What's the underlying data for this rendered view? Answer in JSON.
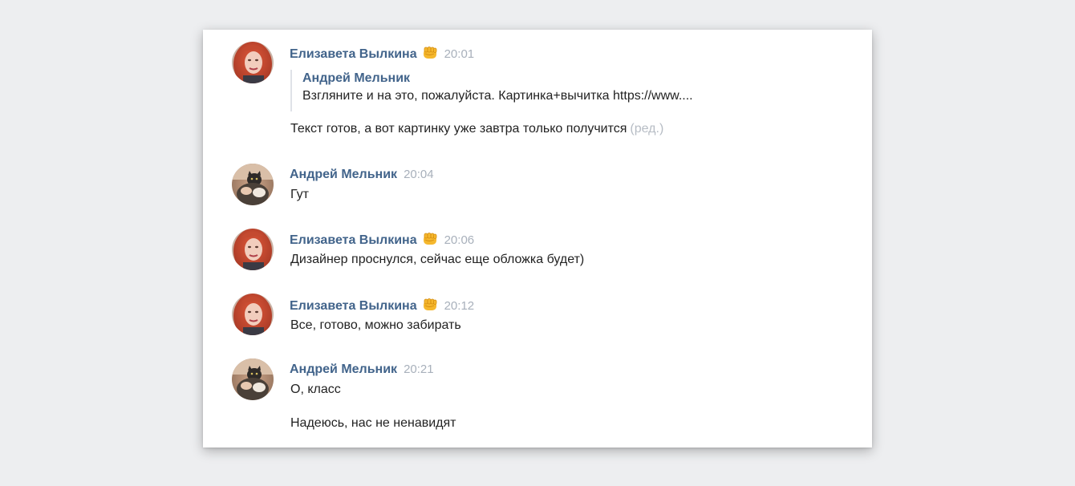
{
  "colors": {
    "background": "#edeef0",
    "author": "#42648b",
    "time": "#a8b0bb",
    "text": "#222222",
    "edited": "#b6bcc4",
    "quote_border": "#dfe2e8"
  },
  "messages": [
    {
      "author": "Елизавета Вылкина",
      "author_emoji": "fist-emoji",
      "time": "20:01",
      "quote": {
        "author": "Андрей Мельник",
        "text": "Взгляните и на это, пожалуйста. Картинка+вычитка https://www...."
      },
      "text": "Текст готов, а вот картинку уже завтра только получится",
      "edited": "(ред.)"
    },
    {
      "author": "Андрей Мельник",
      "time": "20:04",
      "text": "Гут"
    },
    {
      "author": "Елизавета Вылкина",
      "author_emoji": "fist-emoji",
      "time": "20:06",
      "text": "Дизайнер проснулся, сейчас еще обложка будет)"
    },
    {
      "author": "Елизавета Вылкина",
      "author_emoji": "fist-emoji",
      "time": "20:12",
      "text": "Все, готово, можно забирать"
    },
    {
      "author": "Андрей Мельник",
      "time": "20:21",
      "text": "О, класс",
      "text_extra": "Надеюсь, нас не ненавидят"
    }
  ]
}
